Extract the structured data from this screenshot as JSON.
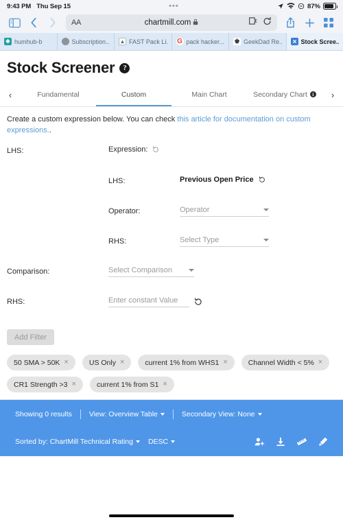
{
  "status_bar": {
    "time": "9:43 PM",
    "date": "Thu Sep 15",
    "dots": "•••",
    "battery_percent": "87%",
    "icons": [
      "location-arrow-icon",
      "wifi-icon",
      "do-not-disturb-icon",
      "battery-icon"
    ]
  },
  "browser": {
    "toolbar": {
      "sidebar_icon": "sidebar-icon",
      "back_icon": "chevron-left-icon",
      "forward_icon": "chevron-right-icon",
      "text_size_label": "AA",
      "url": "chartmill.com",
      "lock_icon": "lock-icon",
      "extensions_icon": "puzzle-piece-icon",
      "reload_icon": "reload-icon",
      "share_icon": "share-icon",
      "new_tab_icon": "plus-icon",
      "tab_overview_icon": "tab-grid-icon"
    },
    "tabs": [
      {
        "label": "humhub-b",
        "favicon": "humhub-favicon",
        "favicon_glyph": "❖",
        "active": false
      },
      {
        "label": "Subscription...",
        "favicon": "subscription-favicon",
        "favicon_glyph": "◔",
        "active": false
      },
      {
        "label": "FAST Pack Li...",
        "favicon": "fast-pack-favicon",
        "favicon_glyph": "▲",
        "active": false
      },
      {
        "label": "pack hacker...",
        "favicon": "google-favicon",
        "favicon_glyph": "G",
        "active": false
      },
      {
        "label": "GeekDad Re...",
        "favicon": "geekdad-favicon",
        "favicon_glyph": "♚",
        "active": false
      },
      {
        "label": "Stock Scree...",
        "favicon": "stock-screener-favicon",
        "favicon_glyph": "☒",
        "active": true
      }
    ]
  },
  "page": {
    "title": "Stock Screener",
    "help_icon_glyph": "?",
    "nav": {
      "prev_arrow": "‹",
      "next_arrow": "›",
      "tabs": [
        {
          "label": "Fundamental",
          "active": false,
          "info": false
        },
        {
          "label": "Custom",
          "active": true,
          "info": false
        },
        {
          "label": "Main Chart",
          "active": false,
          "info": false
        },
        {
          "label": "Secondary Chart",
          "active": false,
          "info": true
        }
      ]
    },
    "description": {
      "before": "Create a custom expression below. You can check ",
      "link": "this article for documentation on custom expressions.",
      "after": "."
    },
    "form": {
      "lhs_label": "LHS:",
      "expression_label": "Expression:",
      "inner_lhs_label": "LHS:",
      "inner_lhs_value": "Previous Open Price",
      "operator_label": "Operator:",
      "operator_value": "Operator",
      "rhs_inner_label": "RHS:",
      "rhs_inner_value": "Select Type",
      "comparison_label": "Comparison:",
      "comparison_value": "Select Comparison",
      "rhs_label": "RHS:",
      "rhs_value": "Enter constant Value",
      "add_filter_label": "Add Filter",
      "reset_icon": "reset-arrow-icon"
    },
    "chips": [
      {
        "label": "50 SMA > 50K",
        "remove_glyph": "×"
      },
      {
        "label": "US Only",
        "remove_glyph": "×"
      },
      {
        "label": "current 1% from WHS1",
        "remove_glyph": "×"
      },
      {
        "label": "Channel Width < 5%",
        "remove_glyph": "×"
      },
      {
        "label": "CR1 Strength >3",
        "remove_glyph": "×"
      },
      {
        "label": "current 1% from S1",
        "remove_glyph": "×"
      }
    ],
    "results": {
      "showing": "Showing 0 results",
      "view": "View: Overview Table",
      "secondary_view": "Secondary View: None",
      "sorted_by": "Sorted by: ChartMill Technical Rating",
      "sort_direction": "DESC",
      "icons": [
        "add-user-icon",
        "download-icon",
        "ruler-icon",
        "pencil-icon"
      ],
      "background_color": "#4f96e8"
    }
  },
  "colors": {
    "accent_blue": "#5b9bd5",
    "link_blue": "#5b9bd5",
    "results_blue": "#4f96e8",
    "browser_chrome": "#f2f4f7",
    "tabstrip": "#dce8f6"
  }
}
